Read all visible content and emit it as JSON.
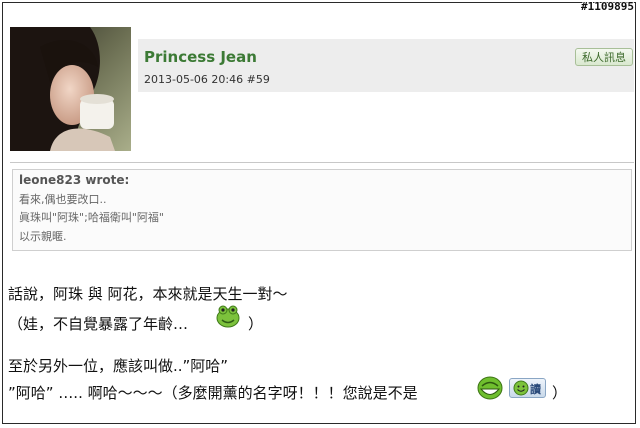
{
  "watermark": "#1109895",
  "post": {
    "author": "Princess Jean",
    "datetime": "2013-05-06 20:46",
    "post_number": "#59",
    "pm_button_label": "私人訊息"
  },
  "quote": {
    "author": "leone823 wrote:",
    "lines": [
      "看來,偶也要改口..",
      "眞珠叫\"阿珠\";哈福衛叫\"阿福\"",
      "以示親暱."
    ]
  },
  "body": {
    "line1": "話說，阿珠 與 阿花，本來就是天生一對～",
    "line2_before": "（娃，不自覺暴露了年齡…",
    "line2_after": "）",
    "line3": "至於另外一位，應該叫做..”阿哈”",
    "line4_before": "”阿哈” ….. 啊哈～～～（多麼開薰的名字呀！！！您說是不是",
    "line4_after": "）",
    "read_badge_label": "讀"
  },
  "colors": {
    "author_green": "#3c7a35",
    "header_bg": "#ededed"
  },
  "icons": {
    "emoticon_1": "green-frog-emoticon-icon",
    "emoticon_2": "green-grin-emoticon-icon",
    "read_badge": "smiley-read-badge-icon"
  }
}
